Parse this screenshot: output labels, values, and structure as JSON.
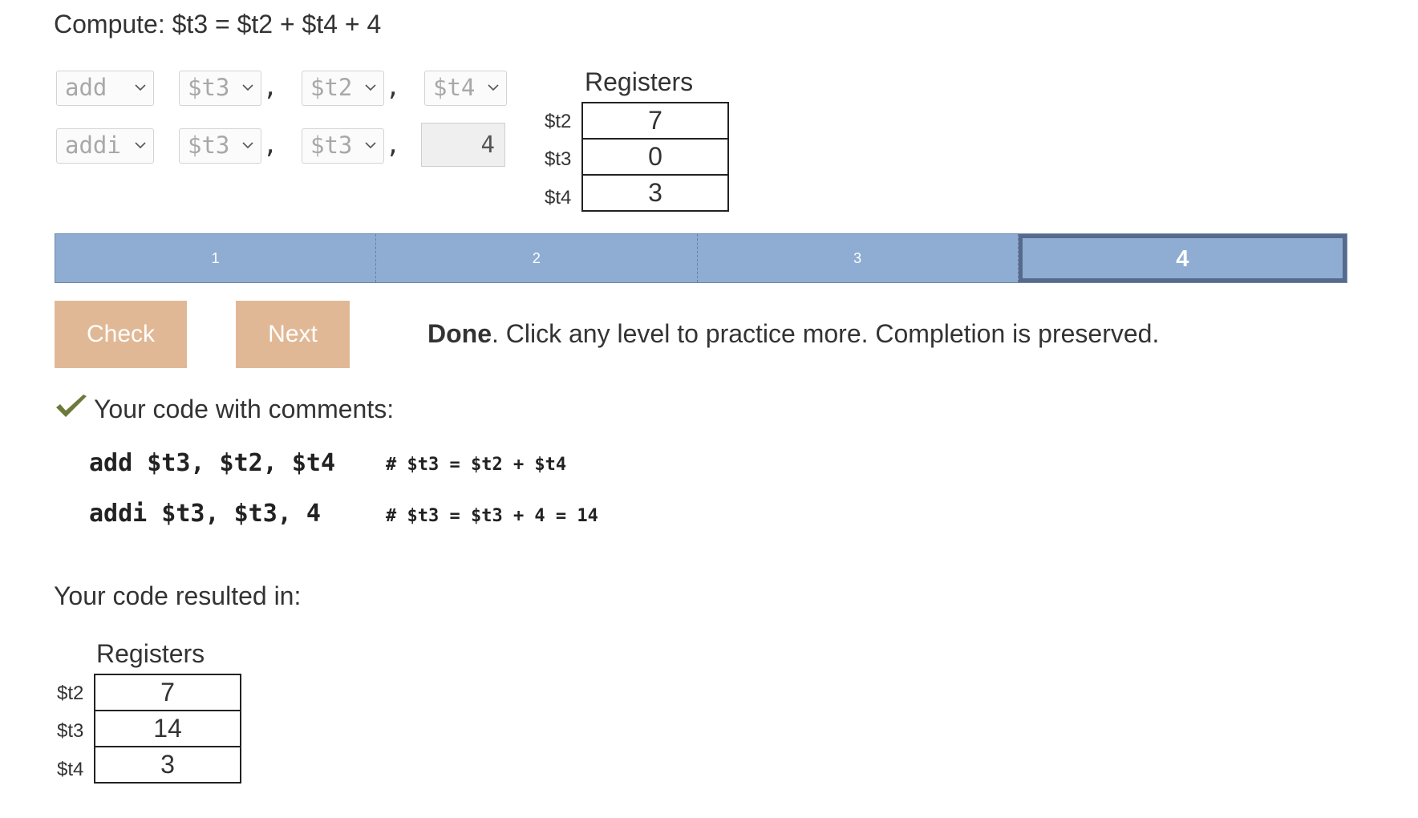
{
  "prompt": "Compute: $t3 = $t2 + $t4 + 4",
  "instructions": [
    {
      "op": "add",
      "rd": "$t3",
      "rs": "$t2",
      "rt": "$t4"
    },
    {
      "op": "addi",
      "rd": "$t3",
      "rs": "$t3",
      "imm": "4"
    }
  ],
  "comma": ",",
  "registers_initial": {
    "title": "Registers",
    "rows": [
      {
        "name": "$t2",
        "value": "7"
      },
      {
        "name": "$t3",
        "value": "0"
      },
      {
        "name": "$t4",
        "value": "3"
      }
    ]
  },
  "levels": [
    "1",
    "2",
    "3",
    "4"
  ],
  "active_level": "4",
  "buttons": {
    "check": "Check",
    "next": "Next"
  },
  "status": {
    "bold": "Done",
    "rest": ". Click any level to practice more. Completion is preserved."
  },
  "comments_title": "Your code with comments:",
  "code_lines": [
    {
      "code": "add $t3, $t2, $t4",
      "comment": "# $t3 = $t2 + $t4"
    },
    {
      "code": "addi $t3, $t3, 4",
      "comment": "# $t3 = $t3 + 4 = 14"
    }
  ],
  "result_title": "Your code resulted in:",
  "registers_result": {
    "title": "Registers",
    "rows": [
      {
        "name": "$t2",
        "value": "7"
      },
      {
        "name": "$t3",
        "value": "14"
      },
      {
        "name": "$t4",
        "value": "3"
      }
    ]
  },
  "colors": {
    "accent_button": "#e1b895",
    "level_bar": "#8fadd2",
    "level_active_border": "#566a8e",
    "check_icon": "#6b7a3a"
  }
}
